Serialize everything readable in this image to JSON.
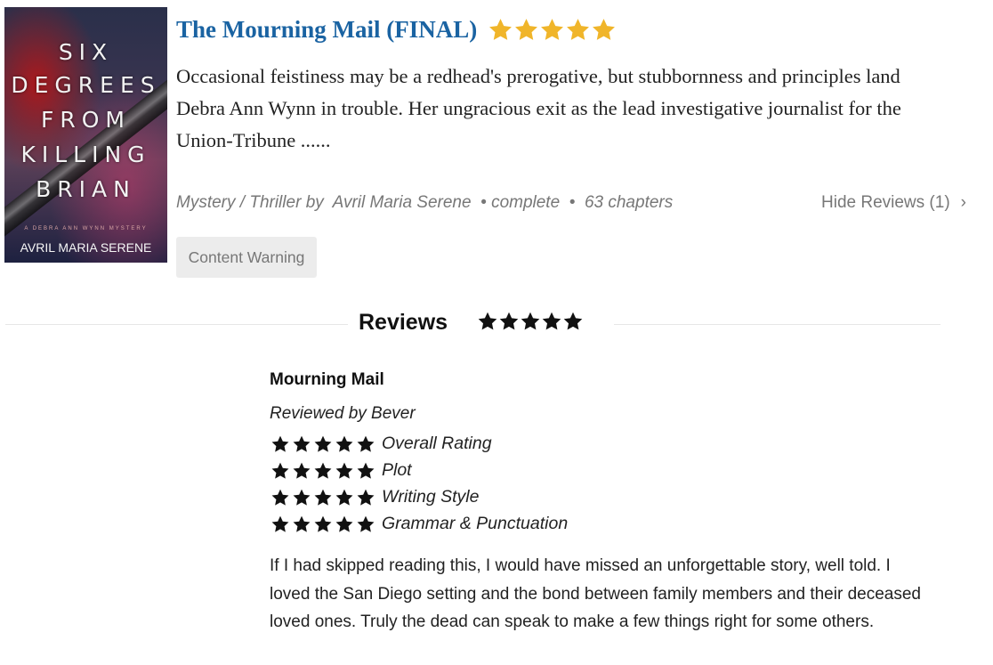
{
  "cover": {
    "title_lines": [
      "SIX",
      "DEGREES",
      "FROM",
      "KILLING",
      "BRIAN"
    ],
    "series_line": "A DEBRA ANN WYNN MYSTERY",
    "author": "AVRIL MARIA SERENE"
  },
  "book": {
    "title": "The Mourning Mail (FINAL)",
    "rating_stars": 5,
    "synopsis": "Occasional feistiness may be a redhead's prerogative, but stubbornness and principles land Debra Ann Wynn in trouble. Her ungracious exit as the lead investigative journalist for the Union-Tribune ......",
    "genre": "Mystery / Thriller",
    "by": "by",
    "author": "Avril Maria Serene",
    "status": "complete",
    "chapters": "63 chapters",
    "hide_reviews": "Hide Reviews (1)",
    "content_warning": "Content Warning"
  },
  "reviews": {
    "heading": "Reviews",
    "overall_stars": 5,
    "items": [
      {
        "title": "Mourning Mail",
        "reviewed_by": "Reviewed by Bever",
        "ratings": [
          {
            "label": "Overall Rating",
            "stars": 5
          },
          {
            "label": "Plot",
            "stars": 5
          },
          {
            "label": "Writing Style",
            "stars": 5
          },
          {
            "label": "Grammar & Punctuation",
            "stars": 5
          }
        ],
        "text": "If I had skipped reading this, I would have missed an unforgettable story, well told.  I loved the San Diego setting and the bond between family members and their deceased loved ones.  Truly the dead can speak to make a few things right for some others."
      }
    ]
  },
  "colors": {
    "title_blue": "#1a63a2",
    "star_gold": "#f0b52a",
    "star_black": "#111111",
    "muted_text": "#777777"
  },
  "icons": {
    "rating_star": "star-icon",
    "chevron": "chevron-right-icon"
  }
}
